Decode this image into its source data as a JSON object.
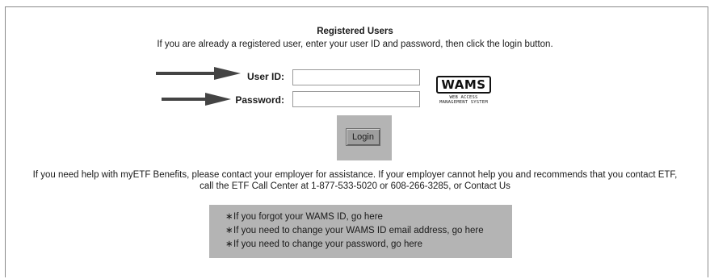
{
  "section": {
    "title": "Registered Users",
    "intro": "If you are already a registered user, enter your user ID and password, then click the login button."
  },
  "form": {
    "user_id_label": "User ID:",
    "user_id_value": "",
    "password_label": "Password:",
    "password_value": "",
    "login_label": "Login"
  },
  "logo": {
    "word": "WAMS",
    "line1": "WEB ACCESS",
    "line2": "MANAGEMENT SYSTEM"
  },
  "help": {
    "line1": "If you need help with myETF Benefits, please contact your employer for assistance. If your employer cannot help you and recommends that you contact ETF,",
    "line2": "call the ETF Call Center at 1-877-533-5020 or 608-266-3285, or Contact Us"
  },
  "links": {
    "bullet": "∗",
    "items": [
      {
        "label": "If you forgot your WAMS ID, go here"
      },
      {
        "label": "If you need to change your WAMS ID email address, go here"
      },
      {
        "label": "If you need to change your password, go here"
      }
    ]
  },
  "colors": {
    "panel": "#b4b4b4",
    "login_button": "#9e9e9e",
    "arrow": "#444444"
  }
}
